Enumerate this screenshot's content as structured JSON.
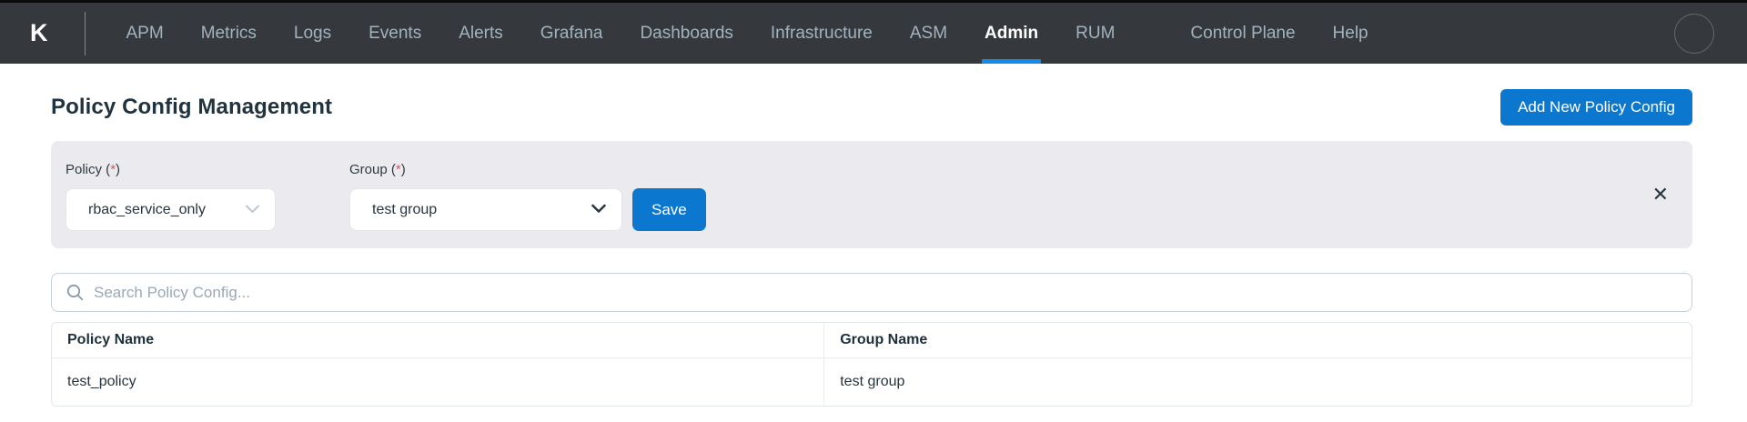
{
  "nav": {
    "logo": "K",
    "items": [
      "APM",
      "Metrics",
      "Logs",
      "Events",
      "Alerts",
      "Grafana",
      "Dashboards",
      "Infrastructure",
      "ASM",
      "Admin",
      "RUM",
      "Control Plane",
      "Help"
    ],
    "active_item": "Admin"
  },
  "page": {
    "title": "Policy Config Management",
    "add_button_label": "Add New Policy Config"
  },
  "form": {
    "policy_label": {
      "prefix": "Policy (",
      "star": "*",
      "suffix": ")"
    },
    "group_label": {
      "prefix": "Group (",
      "star": "*",
      "suffix": ")"
    },
    "policy_value": "rbac_service_only",
    "group_value": "test group",
    "save_label": "Save",
    "close_glyph": "✕"
  },
  "search": {
    "placeholder": "Search Policy Config..."
  },
  "table": {
    "columns": [
      "Policy Name",
      "Group Name"
    ],
    "rows": [
      {
        "policy_name": "test_policy",
        "group_name": "test group"
      }
    ]
  },
  "colors": {
    "accent_blue": "#0b77cf",
    "active_underline": "#1588e8",
    "navbar_bg": "#35393d",
    "required_star": "#e8554f",
    "panel_bg": "#ebebef"
  }
}
